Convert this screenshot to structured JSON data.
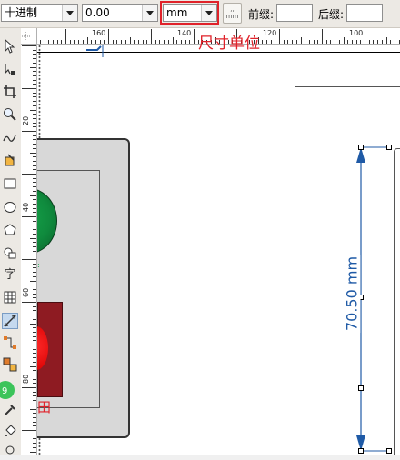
{
  "property_bar": {
    "number_format": "十进制",
    "precision": "0.00",
    "unit": "mm",
    "prefix_label": "前缀:",
    "prefix_value": "",
    "suffix_label": "后缀:",
    "suffix_value": "",
    "unit_button_text": "mm"
  },
  "annotation": {
    "unit_label": "尺寸单位"
  },
  "horizontal_ruler": {
    "labels": [
      "160",
      "140",
      "120",
      "100"
    ]
  },
  "vertical_ruler": {
    "labels": [
      "20",
      "40",
      "60",
      "80"
    ]
  },
  "toolbox": {
    "items": [
      "pick-tool",
      "shape-tool",
      "crop-tool",
      "zoom-tool",
      "freehand-tool",
      "smart-fill-tool",
      "rectangle-tool",
      "ellipse-tool",
      "polygon-tool",
      "basic-shapes-tool",
      "text-tool",
      "table-tool",
      "dimension-tool",
      "connector-tool",
      "blend-tool",
      "eyedropper-tool",
      "fill-tool"
    ],
    "text_tool_label": "字"
  },
  "dimension": {
    "value_text": "70.50 mm"
  },
  "drawing": {
    "partial_text": "田"
  },
  "colors": {
    "dimension_blue": "#1f5aa6",
    "annotation_red": "#e0222a",
    "green_circle": "#1e8f4a",
    "red_block": "#8e1b22"
  }
}
